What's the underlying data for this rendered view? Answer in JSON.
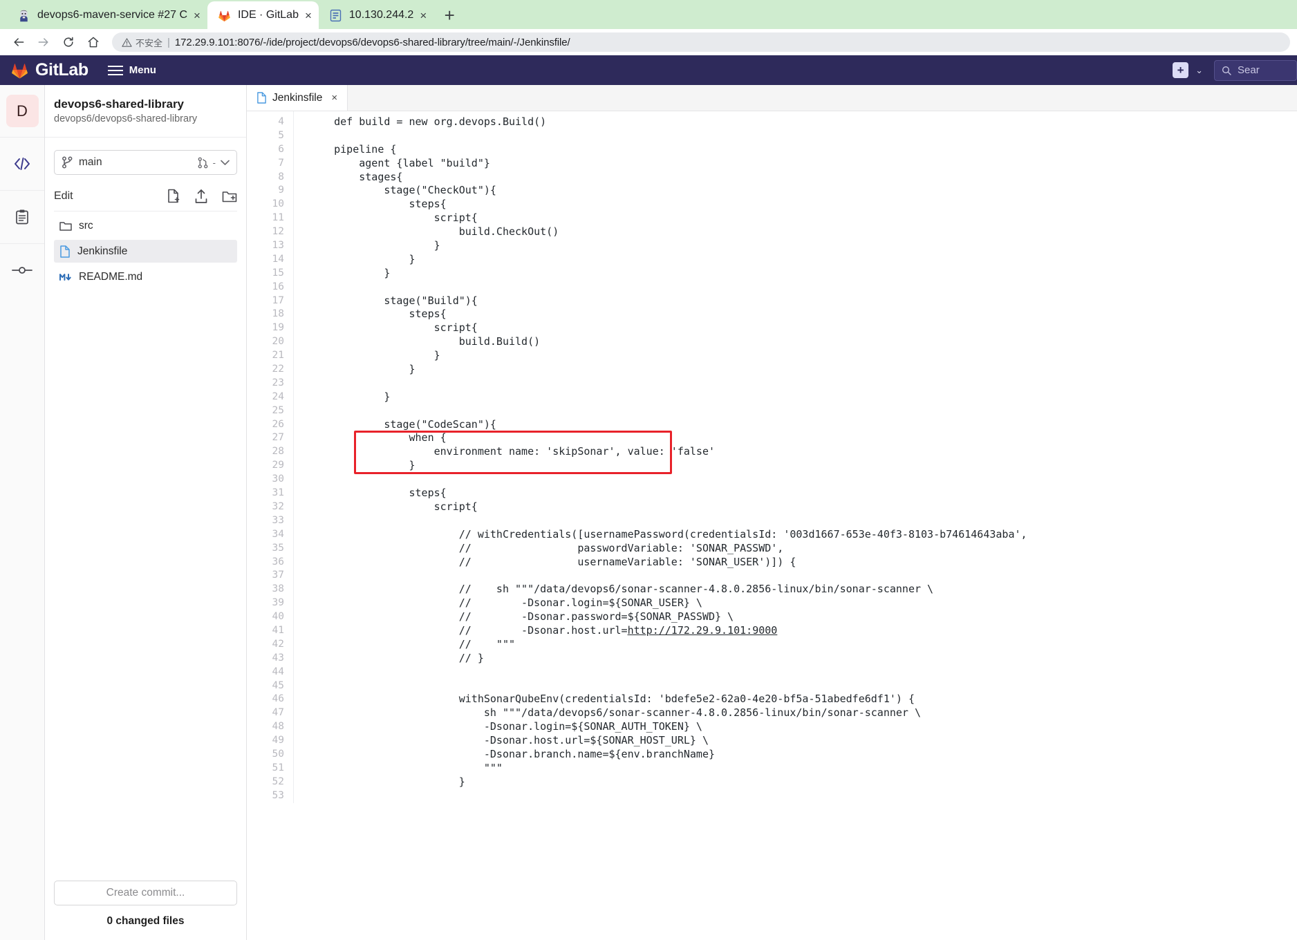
{
  "browser": {
    "tabs": [
      {
        "title": "devops6-maven-service #27 C",
        "favicon": "jenkins-icon",
        "active": false,
        "close_label": "×"
      },
      {
        "title": "IDE · GitLab",
        "favicon": "gitlab-icon",
        "active": true,
        "close_label": "×"
      },
      {
        "title": "10.130.244.2",
        "favicon": "generic-page-icon",
        "active": false,
        "close_label": "×"
      }
    ],
    "new_tab_label": "+",
    "nav": {
      "back": "←",
      "forward": "→",
      "reload": "C",
      "home": "⌂"
    },
    "url_security_label": "不安全",
    "url": "172.29.9.101:8076/-/ide/project/devops6/devops6-shared-library/tree/main/-/Jenkinsfile/"
  },
  "gitlab_header": {
    "brand": "GitLab",
    "menu_label": "Menu",
    "plus_label": "+",
    "chevron": "⌄",
    "search_placeholder": "Sear"
  },
  "rail": {
    "avatar_letter": "D",
    "items": [
      {
        "name": "edit-icon",
        "label": "<⁄>"
      },
      {
        "name": "review-icon",
        "label": "clipboard"
      },
      {
        "name": "commit-icon",
        "label": "commit"
      }
    ]
  },
  "sidebar": {
    "project_name": "devops6-shared-library",
    "project_path": "devops6/devops6-shared-library",
    "branch": "main",
    "branch_mr_label": "-",
    "edit_label": "Edit",
    "files": [
      {
        "name": "src",
        "type": "folder",
        "selected": false
      },
      {
        "name": "Jenkinsfile",
        "type": "file",
        "selected": true
      },
      {
        "name": "README.md",
        "type": "markdown",
        "selected": false
      }
    ],
    "commit_button": "Create commit...",
    "changed_files": "0 changed files"
  },
  "editor": {
    "tab_label": "Jenkinsfile",
    "tab_close": "×",
    "first_line_number": 4,
    "lines": [
      {
        "n": 4,
        "text": "    def build = new org.devops.Build()"
      },
      {
        "n": 5,
        "text": ""
      },
      {
        "n": 6,
        "text": "    pipeline {"
      },
      {
        "n": 7,
        "text": "        agent {label \"build\"}"
      },
      {
        "n": 8,
        "text": "        stages{"
      },
      {
        "n": 9,
        "text": "            stage(\"CheckOut\"){"
      },
      {
        "n": 10,
        "text": "                steps{"
      },
      {
        "n": 11,
        "text": "                    script{"
      },
      {
        "n": 12,
        "text": "                        build.CheckOut()"
      },
      {
        "n": 13,
        "text": "                    }"
      },
      {
        "n": 14,
        "text": "                }"
      },
      {
        "n": 15,
        "text": "            }"
      },
      {
        "n": 16,
        "text": ""
      },
      {
        "n": 17,
        "text": "            stage(\"Build\"){"
      },
      {
        "n": 18,
        "text": "                steps{"
      },
      {
        "n": 19,
        "text": "                    script{"
      },
      {
        "n": 20,
        "text": "                        build.Build()"
      },
      {
        "n": 21,
        "text": "                    }"
      },
      {
        "n": 22,
        "text": "                }"
      },
      {
        "n": 23,
        "text": ""
      },
      {
        "n": 24,
        "text": "            }"
      },
      {
        "n": 25,
        "text": ""
      },
      {
        "n": 26,
        "text": "            stage(\"CodeScan\"){"
      },
      {
        "n": 27,
        "text": "                when {"
      },
      {
        "n": 28,
        "text": "                    environment name: 'skipSonar', value: 'false'"
      },
      {
        "n": 29,
        "text": "                }"
      },
      {
        "n": 30,
        "text": ""
      },
      {
        "n": 31,
        "text": "                steps{"
      },
      {
        "n": 32,
        "text": "                    script{"
      },
      {
        "n": 33,
        "text": ""
      },
      {
        "n": 34,
        "text": "                        // withCredentials([usernamePassword(credentialsId: '003d1667-653e-40f3-8103-b74614643aba',"
      },
      {
        "n": 35,
        "text": "                        //                 passwordVariable: 'SONAR_PASSWD',"
      },
      {
        "n": 36,
        "text": "                        //                 usernameVariable: 'SONAR_USER')]) {"
      },
      {
        "n": 37,
        "text": ""
      },
      {
        "n": 38,
        "text": "                        //    sh \"\"\"/data/devops6/sonar-scanner-4.8.0.2856-linux/bin/sonar-scanner \\"
      },
      {
        "n": 39,
        "text": "                        //        -Dsonar.login=${SONAR_USER} \\"
      },
      {
        "n": 40,
        "text": "                        //        -Dsonar.password=${SONAR_PASSWD} \\"
      },
      {
        "n": 41,
        "text": "                        //        -Dsonar.host.url=http://172.29.9.101:9000",
        "link": "http://172.29.9.101:9000"
      },
      {
        "n": 42,
        "text": "                        //    \"\"\""
      },
      {
        "n": 43,
        "text": "                        // }"
      },
      {
        "n": 44,
        "text": ""
      },
      {
        "n": 45,
        "text": ""
      },
      {
        "n": 46,
        "text": "                        withSonarQubeEnv(credentialsId: 'bdefe5e2-62a0-4e20-bf5a-51abedfe6df1') {"
      },
      {
        "n": 47,
        "text": "                            sh \"\"\"/data/devops6/sonar-scanner-4.8.0.2856-linux/bin/sonar-scanner \\"
      },
      {
        "n": 48,
        "text": "                            -Dsonar.login=${SONAR_AUTH_TOKEN} \\"
      },
      {
        "n": 49,
        "text": "                            -Dsonar.host.url=${SONAR_HOST_URL} \\"
      },
      {
        "n": 50,
        "text": "                            -Dsonar.branch.name=${env.branchName}"
      },
      {
        "n": 51,
        "text": "                            \"\"\""
      },
      {
        "n": 52,
        "text": "                        }"
      },
      {
        "n": 53,
        "text": ""
      }
    ],
    "highlight": {
      "color": "#e8222a",
      "from_line": 27,
      "to_line": 29,
      "label": "when-block-highlight"
    }
  },
  "colors": {
    "gitlab_navy": "#2e2a5b",
    "tabbar_green": "#cfeccf",
    "highlight_red": "#e8222a",
    "selected_file_bg": "#ececef"
  }
}
